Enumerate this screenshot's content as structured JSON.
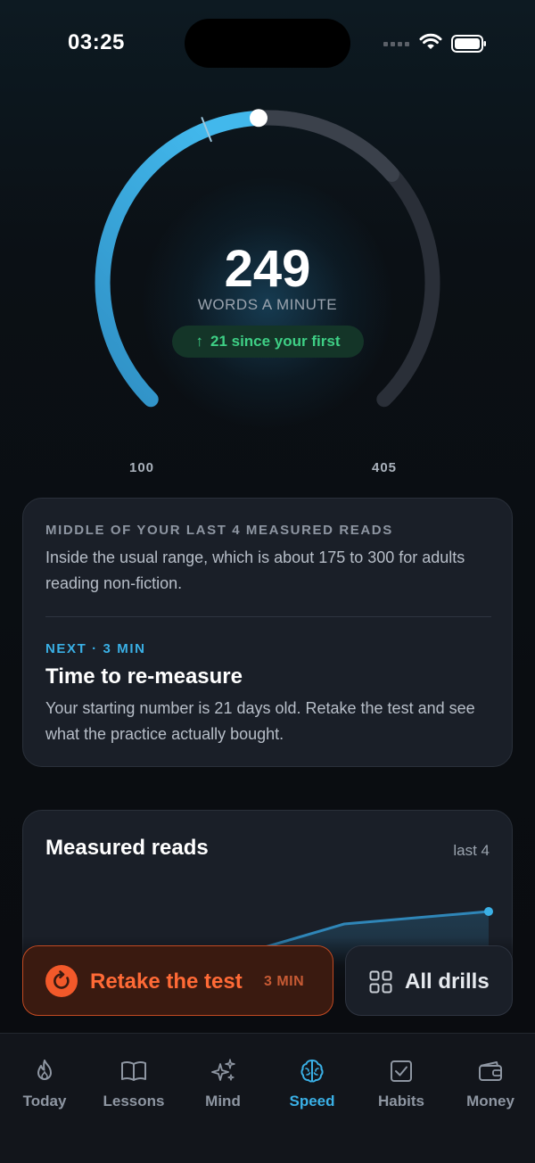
{
  "status": {
    "time": "03:25"
  },
  "gauge": {
    "value": "249",
    "unit_label": "WORDS A MINUTE",
    "delta_text": "21 since your first",
    "delta_arrow": "↑",
    "min_label": "100",
    "max_label": "405",
    "min": 100,
    "max": 405,
    "current": 249,
    "first_marker": 228,
    "accent_color": "#3ab0e6"
  },
  "info_card": {
    "overline": "MIDDLE OF YOUR LAST 4 MEASURED READS",
    "body": "Inside the usual range, which is about 175 to 300 for adults reading non-fiction.",
    "next_tag": "NEXT · 3 MIN",
    "next_title": "Time to re-measure",
    "next_body": "Your starting number is 21 days old. Retake the test and see what the practice actually bought."
  },
  "reads_card": {
    "title": "Measured reads",
    "range": "last 4"
  },
  "actions": {
    "retake_label": "Retake the test",
    "retake_duration": "3 MIN",
    "drills_label": "All drills"
  },
  "tabs": [
    {
      "label": "Today",
      "icon": "flame-icon",
      "active": false
    },
    {
      "label": "Lessons",
      "icon": "book-icon",
      "active": false
    },
    {
      "label": "Mind",
      "icon": "sparkles-icon",
      "active": false
    },
    {
      "label": "Speed",
      "icon": "brain-icon",
      "active": true
    },
    {
      "label": "Habits",
      "icon": "checkbox-icon",
      "active": false
    },
    {
      "label": "Money",
      "icon": "wallet-icon",
      "active": false
    }
  ]
}
